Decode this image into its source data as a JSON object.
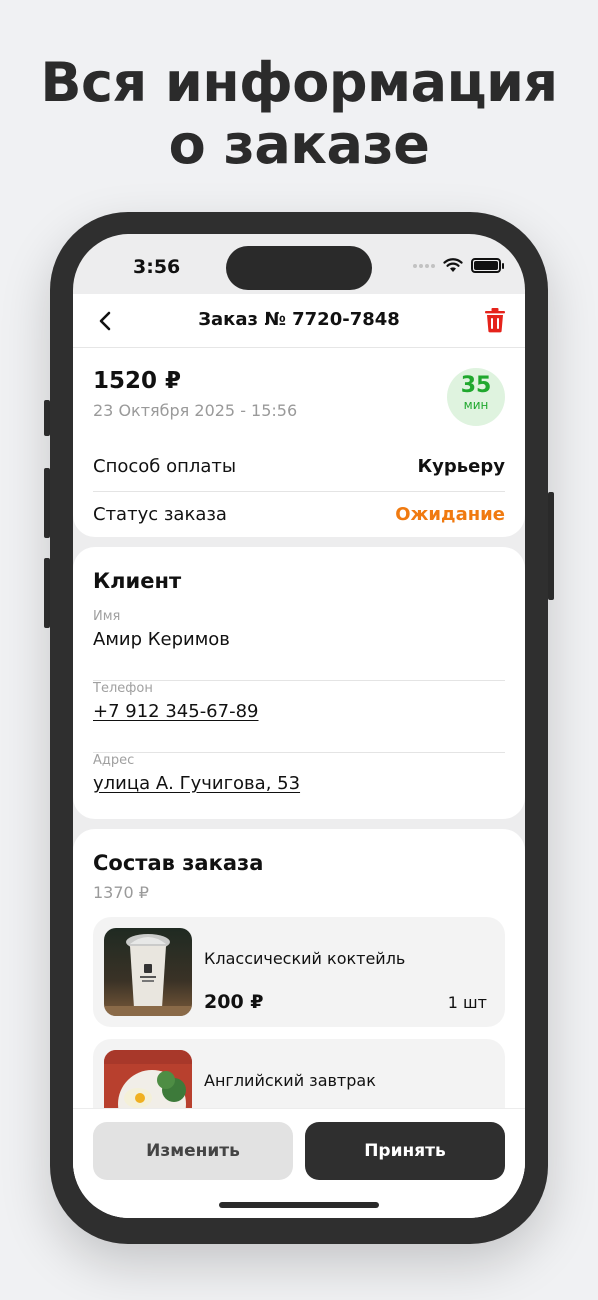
{
  "promo": {
    "headline_line1": "Вся информация",
    "headline_line2": "о заказе"
  },
  "status_bar": {
    "time": "3:56"
  },
  "nav": {
    "title": "Заказ № 7720-7848"
  },
  "summary": {
    "price": "1520 ₽",
    "date": "23 Октября 2025 - 15:56",
    "prep_time_value": "35",
    "prep_time_unit": "мин",
    "payment_label": "Способ оплаты",
    "payment_value": "Курьеру",
    "status_label": "Статус заказа",
    "status_value": "Ожидание"
  },
  "client": {
    "title": "Клиент",
    "name_label": "Имя",
    "name": "Амир Керимов",
    "phone_label": "Телефон",
    "phone": "+7 912 345-67-89",
    "address_label": "Адрес",
    "address": "улица А. Гучигова, 53"
  },
  "order": {
    "title": "Состав заказа",
    "subtotal": "1370 ₽",
    "items": [
      {
        "name": "Классический коктейль",
        "price": "200 ₽",
        "qty": "1 шт"
      },
      {
        "name": "Английский завтрак",
        "price": "",
        "qty": ""
      }
    ]
  },
  "actions": {
    "edit_label": "Изменить",
    "accept_label": "Принять"
  },
  "colors": {
    "accent_orange": "#f07a10",
    "badge_green": "#20a82e",
    "trash_red": "#e5231b",
    "dark": "#2f2f2f"
  },
  "icons": [
    "back-chevron-icon",
    "trash-icon",
    "wifi-icon",
    "battery-icon"
  ]
}
